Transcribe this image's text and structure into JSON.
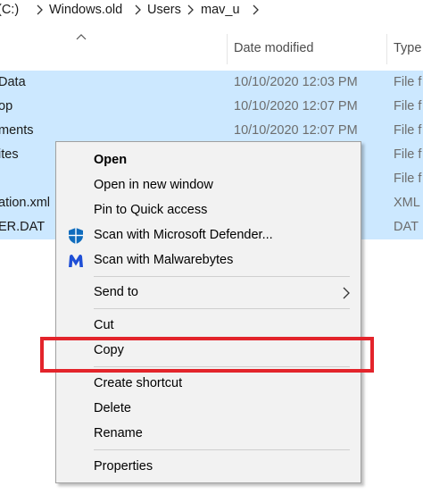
{
  "breadcrumb": [
    {
      "label": "(C:)"
    },
    {
      "label": "Windows.old"
    },
    {
      "label": "Users"
    },
    {
      "label": "mav_u"
    }
  ],
  "columns": {
    "date": "Date modified",
    "type": "Type"
  },
  "files": [
    {
      "name": "Data",
      "date": "10/10/2020 12:03 PM",
      "type": "File f"
    },
    {
      "name": "op",
      "date": "10/10/2020 12:07 PM",
      "type": "File f"
    },
    {
      "name": "ments",
      "date": "10/10/2020 12:07 PM",
      "type": "File f"
    },
    {
      "name": "ites",
      "date": "",
      "type": "File f"
    },
    {
      "name": "",
      "date": "",
      "type": "File f"
    },
    {
      "name": "ation.xml",
      "date": "",
      "type": "XML"
    },
    {
      "name": "ER.DAT",
      "date": "",
      "type": "DAT"
    }
  ],
  "context_menu": {
    "items": [
      {
        "label": "Open"
      },
      {
        "label": "Open in new window"
      },
      {
        "label": "Pin to Quick access"
      },
      {
        "label": "Scan with Microsoft Defender..."
      },
      {
        "label": "Scan with Malwarebytes"
      },
      {
        "label": "Send to"
      },
      {
        "label": "Cut"
      },
      {
        "label": "Copy"
      },
      {
        "label": "Create shortcut"
      },
      {
        "label": "Delete"
      },
      {
        "label": "Rename"
      },
      {
        "label": "Properties"
      }
    ]
  },
  "icons": {
    "defender": "shield-icon",
    "malwarebytes": "malwarebytes-icon",
    "submenu": "chevron-right-icon"
  },
  "colors": {
    "selection": "#cce8ff",
    "menu_bg": "#f2f2f2",
    "highlight": "#e3242b",
    "defender_blue": "#0f6cbd",
    "malwarebytes_blue": "#1f4fd6"
  }
}
